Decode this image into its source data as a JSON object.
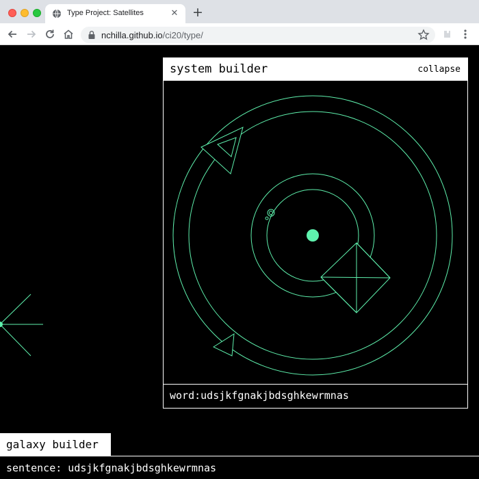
{
  "browser": {
    "tab_title": "Type Project: Satellites",
    "url_host": "nchilla.github.io",
    "url_path": "/ci20/type/"
  },
  "colors": {
    "accent": "#5ff2ae",
    "background": "#000000",
    "panel_border": "#ffffff"
  },
  "icons": [
    "globe-icon",
    "close-icon",
    "plus-icon",
    "back-arrow-icon",
    "forward-arrow-icon",
    "reload-icon",
    "home-icon",
    "lock-icon",
    "star-icon",
    "extension-icon",
    "menu-icon"
  ],
  "system_builder": {
    "title": "system builder",
    "collapse_label": "collapse",
    "word": "word:udsjkfgnakjbdsghkewrmnas"
  },
  "galaxy_builder": {
    "label": "galaxy builder",
    "sentence": "sentence: udsjkfgnakjbdsghkewrmnas"
  }
}
